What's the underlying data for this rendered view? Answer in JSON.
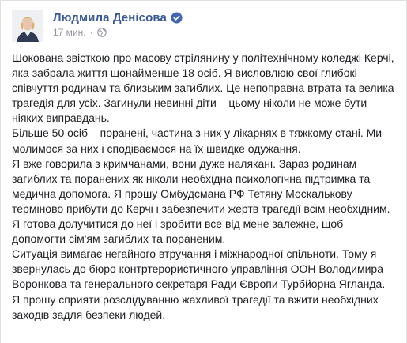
{
  "post": {
    "author": "Людмила Денісова",
    "time": "17 мин.",
    "separator": "·",
    "icons": {
      "avatar": "profile-photo",
      "verified": "verified-badge-icon",
      "audience": "globe-icon"
    },
    "colors": {
      "author": "#385898",
      "verified": "#4267b2",
      "meta": "#90949c",
      "text": "#1c1e21"
    },
    "paragraphs": [
      "Шокована звісткою про масову стрілянину у політехнічному коледжі Керчі, яка забрала життя щонайменше 18 осіб. Я висловлюю свої глибокі співчуття родинам та близьким загиблих. Це непоправна втрата та велика трагедія для усіх. Загинули невинні діти – цьому ніколи не може бути ніяких виправдань.",
      "Більше 50 осіб – поранені, частина з них у лікарнях в тяжкому стані. Ми молимося за них і сподіваємося на їх швидке одужання.",
      "Я вже говорила з кримчанами, вони дуже налякані. Зараз родинам загиблих та поранених як ніколи необхідна психологічна підтримка та медична допомога. Я прошу Омбудсмана РФ Тетяну Москалькову терміново прибути до Керчі і забезпечити жертв трагедії всім необхідним. Я готова долучитися до неї і зробити все від мене залежне, щоб допомогти сім'ям загиблих та пораненим.",
      "Ситуація вимагає негайного втручання і міжнародної спільноти. Тому я звернулась до бюро контртерористичного управління ООН Володимира Воронкова та генерального секретаря Ради Європи Турбйорна Ягланда. Я прошу сприяти розслідуванню жахливої трагедії та вжити необхідних заходів задля безпеки людей."
    ]
  }
}
